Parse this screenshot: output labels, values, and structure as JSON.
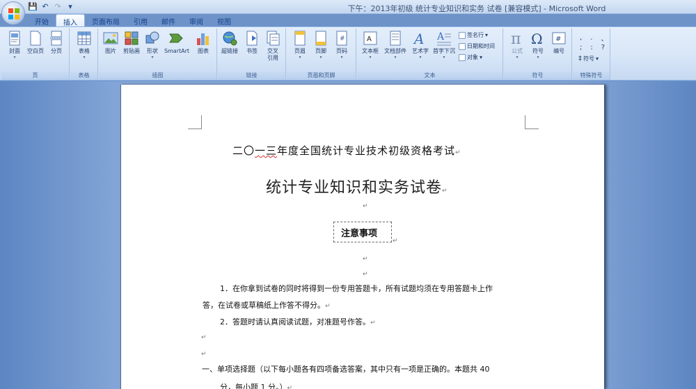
{
  "window": {
    "title": "下午：2013年初级 统计专业知识和实务 试卷 [兼容模式] - Microsoft Word"
  },
  "tabs": [
    {
      "label": "开始"
    },
    {
      "label": "插入"
    },
    {
      "label": "页面布局"
    },
    {
      "label": "引用"
    },
    {
      "label": "邮件"
    },
    {
      "label": "审阅"
    },
    {
      "label": "视图"
    }
  ],
  "ribbon": {
    "groups": {
      "pages": {
        "label": "页",
        "buttons": [
          "封面",
          "空白页",
          "分页"
        ]
      },
      "tables": {
        "label": "表格",
        "buttons": [
          "表格"
        ]
      },
      "illustrations": {
        "label": "插图",
        "buttons": [
          "图片",
          "剪贴画",
          "形状",
          "SmartArt",
          "图表"
        ]
      },
      "links": {
        "label": "链接",
        "buttons": [
          "超链接",
          "书签",
          "交叉",
          "引用"
        ]
      },
      "header_footer": {
        "label": "页眉和页脚",
        "buttons": [
          "页眉",
          "页脚",
          "页码"
        ]
      },
      "text": {
        "label": "文本",
        "buttons": [
          "文本框",
          "文档部件",
          "艺术字",
          "首字下沉"
        ],
        "small": [
          "签名行",
          "日期和时间",
          "对象"
        ]
      },
      "symbols": {
        "label": "符号",
        "buttons": [
          "公式",
          "符号",
          "编号"
        ]
      },
      "special": {
        "label": "特殊符号",
        "small": [
          "符号"
        ]
      }
    }
  },
  "document": {
    "heading1": "二〇一三年度全国统计专业技术初级资格考试",
    "heading1_wavy": "一三",
    "heading2": "统计专业知识和实务试卷",
    "notice": "注意事项",
    "para1_line1": "1．在你拿到试卷的同时将得到一份专用答题卡，所有试题均须在专用答题卡上作",
    "para1_line2": "答，在试卷或草稿纸上作答不得分。",
    "para2": "2．答题时请认真阅读试题，对准题号作答。",
    "section1_line1": "一、单项选择题（以下每小题各有四项备选答案，其中只有一项是正确的。本题共 40",
    "section1_line2": "分，每小题 1 分。）",
    "return_mark": "↵"
  },
  "colors": {
    "ribbon_bg": "#d6e5f7",
    "tab_text": "#15428b",
    "workspace_bg": "#86a7d8"
  }
}
